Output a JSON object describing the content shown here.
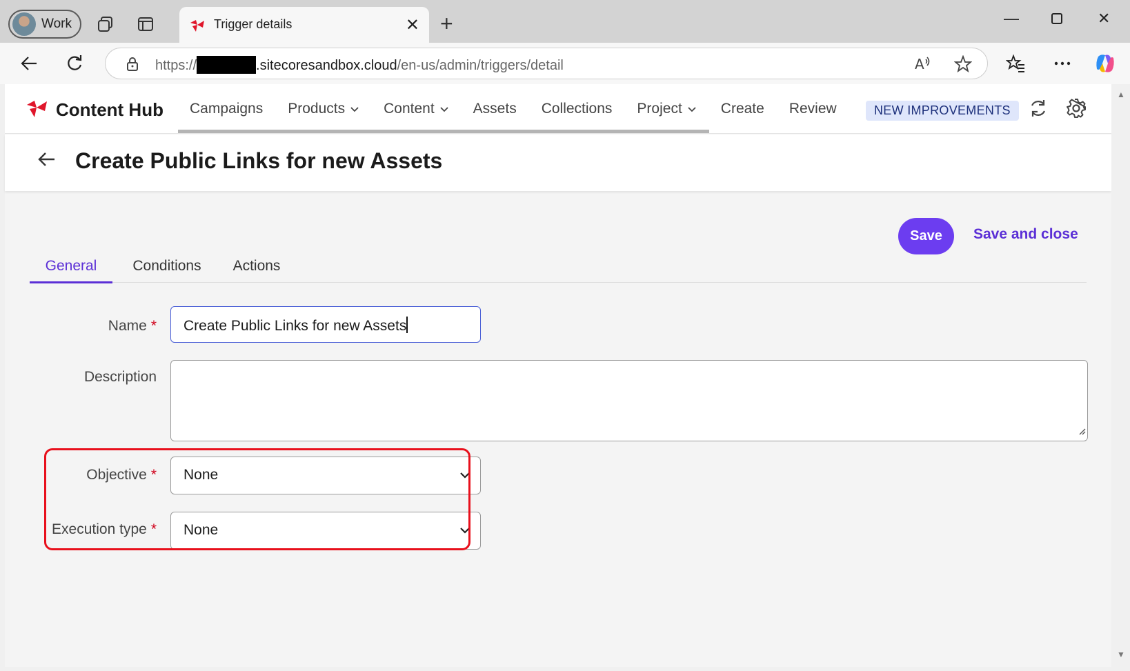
{
  "browser": {
    "profile_label": "Work",
    "tab_title": "Trigger details",
    "url_scheme": "https://",
    "url_host": ".sitecoresandbox.cloud",
    "url_path": "/en-us/admin/triggers/detail"
  },
  "app": {
    "brand": "Content Hub",
    "nav": [
      {
        "label": "Campaigns"
      },
      {
        "label": "Products"
      },
      {
        "label": "Content"
      },
      {
        "label": "Assets"
      },
      {
        "label": "Collections"
      },
      {
        "label": "Project"
      },
      {
        "label": "Create"
      },
      {
        "label": "Review"
      }
    ],
    "badge": "NEW IMPROVEMENTS"
  },
  "page": {
    "title": "Create Public Links for new Assets",
    "save_label": "Save",
    "save_close_label": "Save and close",
    "tabs": [
      {
        "label": "General",
        "active": true
      },
      {
        "label": "Conditions",
        "active": false
      },
      {
        "label": "Actions",
        "active": false
      }
    ]
  },
  "form": {
    "name_label": "Name",
    "name_value": "Create Public Links for new Assets",
    "description_label": "Description",
    "description_value": "",
    "objective_label": "Objective",
    "objective_value": "None",
    "execution_label": "Execution type",
    "execution_value": "None",
    "required_mark": "*"
  },
  "colors": {
    "accent": "#6c3df0",
    "highlight_border": "#e8101c",
    "brand_red": "#e0162b"
  }
}
